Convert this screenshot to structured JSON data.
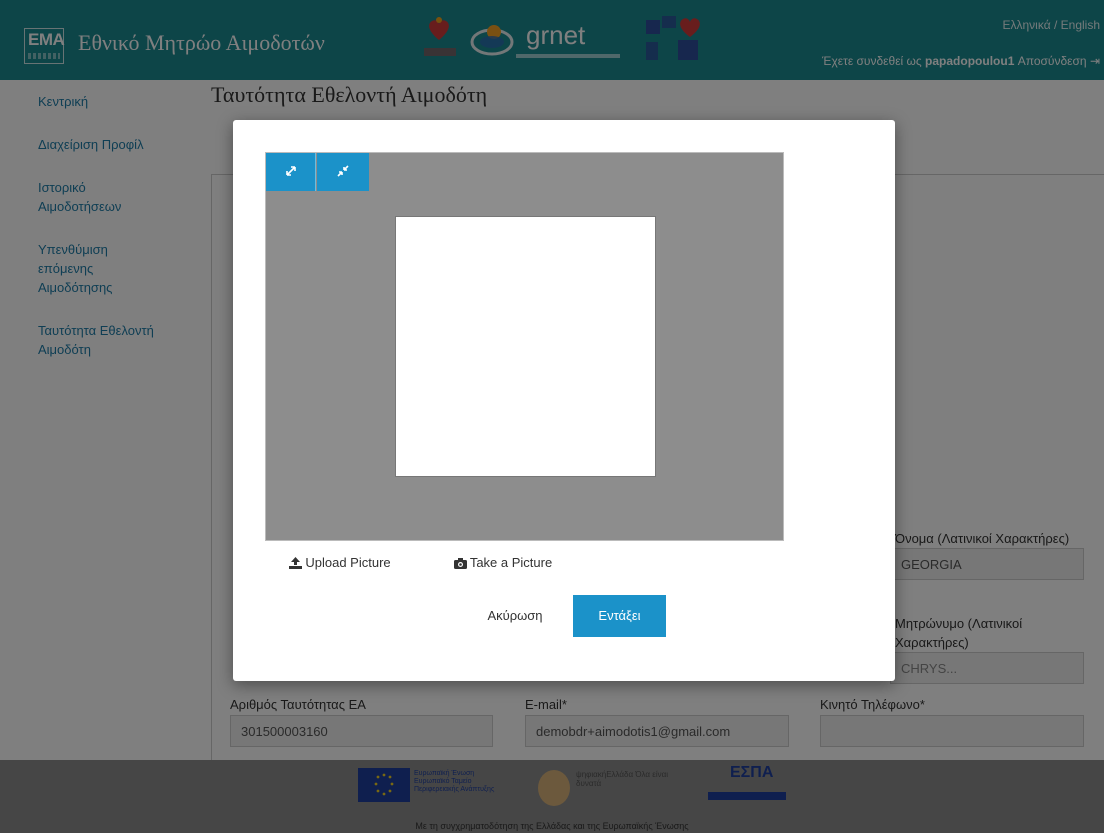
{
  "header": {
    "logo_text": "EMA",
    "site_title": "Εθνικό Μητρώο Αιμοδοτών",
    "partner_grnet": "grnet",
    "lang": "Ελληνικά / English",
    "user_prefix": "Έχετε συνδεθεί ως",
    "username": "papadopoulou1",
    "logout": "Αποσύνδεση"
  },
  "sidebar": {
    "items": [
      {
        "label": "Κεντρική"
      },
      {
        "label": "Διαχείριση Προφίλ"
      },
      {
        "label": "Ιστορικό Αιμοδοτήσεων"
      },
      {
        "label": "Υπενθύμιση επόμενης Αιμοδότησης"
      },
      {
        "label": "Ταυτότητα Εθελοντή Αιμοδότη"
      }
    ]
  },
  "page": {
    "title": "Ταυτότητα Εθελοντή Αιμοδότη"
  },
  "form": {
    "first_name_latin": {
      "label": "Όνομα (Λατινικοί Χαρακτήρες)",
      "value": "GEORGIA"
    },
    "mother_name_latin": {
      "label": "Μητρώνυμο (Λατινικοί Χαρακτήρες)",
      "value": "CHRYS..."
    },
    "id_number": {
      "label": "Αριθμός Ταυτότητας ΕΑ",
      "value": "301500003160"
    },
    "email": {
      "label": "E-mail*",
      "value": "demobdr+aimodotis1@gmail.com"
    },
    "mobile": {
      "label": "Κινητό Τηλέφωνο*",
      "value": ""
    }
  },
  "modal": {
    "upload_label": "Upload Picture",
    "take_label": "Take a Picture",
    "cancel_label": "Ακύρωση",
    "ok_label": "Εντάξει"
  },
  "footer": {
    "eu_text": "Ευρωπαϊκή Ένωση Ευρωπαϊκό Ταμείο Περιφερειακής Ανάπτυξης",
    "digital_text": "ψηφιακήΕλλάδα Όλα είναι δυνατά",
    "espa": "ΕΣΠΑ",
    "caption": "Με τη συγχρηματοδότηση της Ελλάδας και της Ευρωπαϊκής Ένωσης"
  },
  "colors": {
    "header_bg": "#1b8a91",
    "accent_blue": "#1b92c9",
    "link_blue": "#1e7da8"
  }
}
